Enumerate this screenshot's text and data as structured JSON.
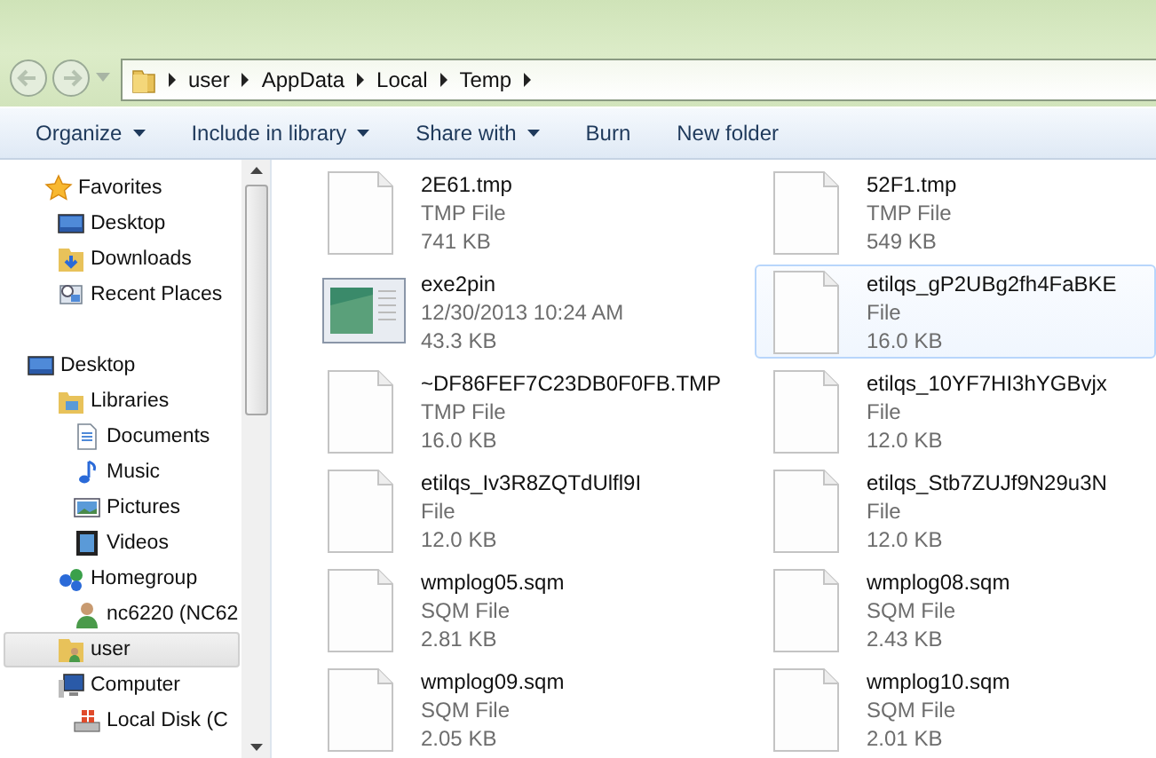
{
  "address_bar": {
    "path": [
      "user",
      "AppData",
      "Local",
      "Temp"
    ]
  },
  "toolbar": {
    "buttons": [
      {
        "label": "Organize",
        "dropdown": true
      },
      {
        "label": "Include in library",
        "dropdown": true
      },
      {
        "label": "Share with",
        "dropdown": true
      },
      {
        "label": "Burn",
        "dropdown": false
      },
      {
        "label": "New folder",
        "dropdown": false
      }
    ]
  },
  "navigation_pane": {
    "items": [
      {
        "label": "Favorites",
        "kind": "star",
        "selected": false,
        "children": [
          {
            "label": "Desktop",
            "kind": "desktop",
            "selected": false
          },
          {
            "label": "Downloads",
            "kind": "downloads",
            "selected": false
          },
          {
            "label": "Recent Places",
            "kind": "recent",
            "selected": false
          }
        ]
      },
      {
        "label": "Desktop",
        "kind": "desktop",
        "selected": false,
        "children": [
          {
            "label": "Libraries",
            "kind": "libraries",
            "selected": false,
            "children": [
              {
                "label": "Documents",
                "kind": "document",
                "selected": false
              },
              {
                "label": "Music",
                "kind": "music",
                "selected": false
              },
              {
                "label": "Pictures",
                "kind": "pictures",
                "selected": false
              },
              {
                "label": "Videos",
                "kind": "videos",
                "selected": false
              }
            ]
          },
          {
            "label": "Homegroup",
            "kind": "homegroup",
            "selected": false,
            "children": [
              {
                "label": "nc6220 (NC62",
                "kind": "user",
                "selected": false
              }
            ]
          },
          {
            "label": "user",
            "kind": "userfolder",
            "selected": true
          },
          {
            "label": "Computer",
            "kind": "computer",
            "selected": false,
            "children": [
              {
                "label": "Local Disk (C",
                "kind": "disk",
                "selected": false
              }
            ]
          }
        ]
      }
    ]
  },
  "files": [
    {
      "name": "2E61.tmp",
      "line_2": "TMP File",
      "line_3": "741 KB",
      "kind": "file",
      "selected": false
    },
    {
      "name": "52F1.tmp",
      "line_2": "TMP File",
      "line_3": "549 KB",
      "kind": "file",
      "selected": false
    },
    {
      "name": "exe2pin",
      "line_2": "12/30/2013 10:24 AM",
      "line_3": "43.3 KB",
      "kind": "app",
      "selected": false
    },
    {
      "name": "etilqs_gP2UBg2fh4FaBKE",
      "line_2": "File",
      "line_3": "16.0 KB",
      "kind": "file",
      "selected": true
    },
    {
      "name": "~DF86FEF7C23DB0F0FB.TMP",
      "line_2": "TMP File",
      "line_3": "16.0 KB",
      "kind": "file",
      "selected": false
    },
    {
      "name": "etilqs_10YF7HI3hYGBvjx",
      "line_2": "File",
      "line_3": "12.0 KB",
      "kind": "file",
      "selected": false
    },
    {
      "name": "etilqs_Iv3R8ZQTdUlfl9I",
      "line_2": "File",
      "line_3": "12.0 KB",
      "kind": "file",
      "selected": false
    },
    {
      "name": "etilqs_Stb7ZUJf9N29u3N",
      "line_2": "File",
      "line_3": "12.0 KB",
      "kind": "file",
      "selected": false
    },
    {
      "name": "wmplog05.sqm",
      "line_2": "SQM File",
      "line_3": "2.81 KB",
      "kind": "file",
      "selected": false
    },
    {
      "name": "wmplog08.sqm",
      "line_2": "SQM File",
      "line_3": "2.43 KB",
      "kind": "file",
      "selected": false
    },
    {
      "name": "wmplog09.sqm",
      "line_2": "SQM File",
      "line_3": "2.05 KB",
      "kind": "file",
      "selected": false
    },
    {
      "name": "wmplog10.sqm",
      "line_2": "SQM File",
      "line_3": "2.01 KB",
      "kind": "file",
      "selected": false
    }
  ]
}
